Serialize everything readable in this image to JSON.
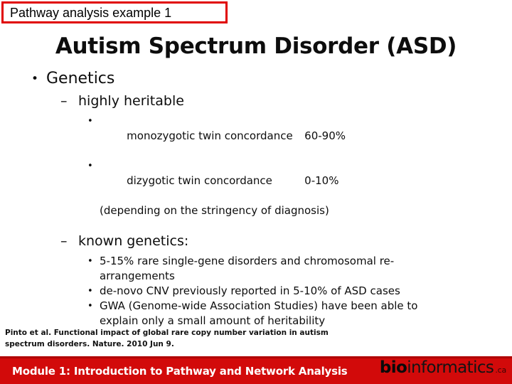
{
  "annotation": {
    "label": "Pathway analysis example 1",
    "border_color": "#e00000"
  },
  "slide": {
    "title": "Autism Spectrum Disorder (ASD)"
  },
  "content": {
    "level1": {
      "bullet_glyph": "•",
      "text": "Genetics"
    },
    "sections": [
      {
        "dash_glyph": "–",
        "heading": "highly heritable",
        "items": [
          {
            "bullet_glyph": "•",
            "label": "monozygotic twin concordance",
            "value": "60-90%"
          },
          {
            "bullet_glyph": "•",
            "label": "dizygotic twin concordance",
            "value": "0-10%"
          }
        ],
        "note": "(depending on the stringency of diagnosis)"
      },
      {
        "dash_glyph": "–",
        "heading": "known genetics:",
        "items": [
          {
            "bullet_glyph": "•",
            "text": "5-15% rare single-gene disorders and chromosomal re-",
            "continuation": "arrangements"
          },
          {
            "bullet_glyph": "•",
            "text": "de-novo CNV previously reported in 5-10% of ASD cases"
          },
          {
            "bullet_glyph": "•",
            "text": "GWA (Genome-wide Association Studies) have been able to",
            "continuation": "explain only a small amount of heritability"
          }
        ]
      }
    ]
  },
  "citation": {
    "line1": "Pinto et al. Functional impact of global rare copy number variation in autism",
    "line2": "spectrum disorders. Nature. 2010 Jun 9."
  },
  "footer": {
    "module_title": "Module 1: Introduction to Pathway and Network Analysis",
    "bar_color": "#d20a0a",
    "logo": {
      "bold_part": "bio",
      "light_part": "informatics",
      "suffix": ".ca"
    }
  }
}
